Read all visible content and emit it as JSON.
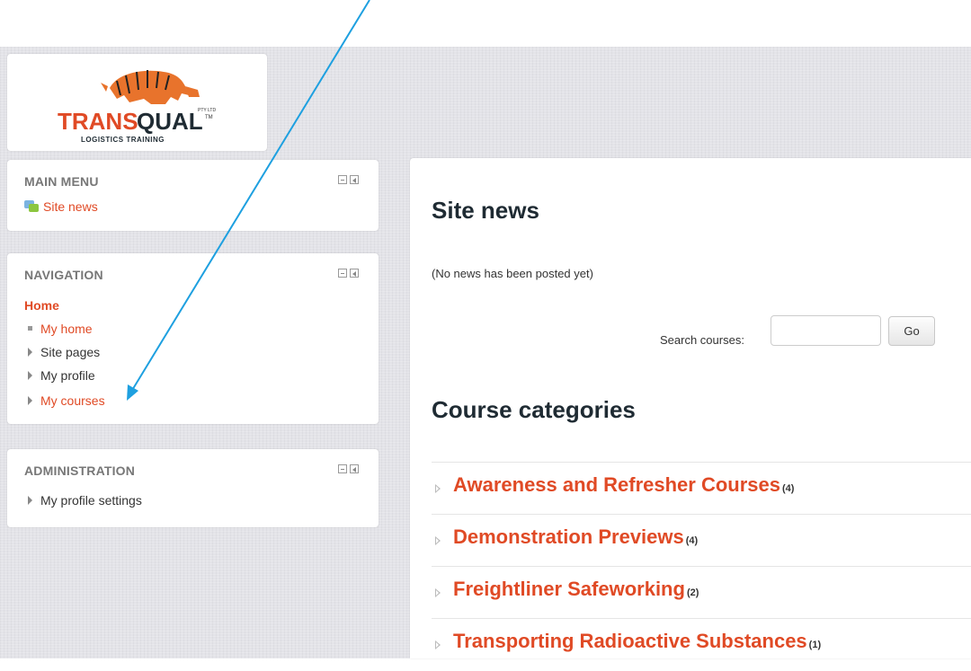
{
  "logo": {
    "brand_left": "TRANS",
    "brand_right": "QUAL",
    "tagline": "LOGISTICS TRAINING",
    "pty": "PTY LTD",
    "tm": "TM"
  },
  "main_menu": {
    "title": "MAIN MENU",
    "items": [
      {
        "label": "Site news",
        "icon": "site-news-icon"
      }
    ]
  },
  "navigation": {
    "title": "NAVIGATION",
    "home": "Home",
    "items": [
      {
        "label": "My home",
        "marker": "square"
      },
      {
        "label": "Site pages",
        "marker": "triangle"
      },
      {
        "label": "My profile",
        "marker": "triangle"
      },
      {
        "label": "My courses",
        "marker": "triangle"
      }
    ]
  },
  "administration": {
    "title": "ADMINISTRATION",
    "items": [
      {
        "label": "My profile settings"
      }
    ]
  },
  "content": {
    "site_news_heading": "Site news",
    "no_news": "(No news has been posted yet)",
    "search_label": "Search courses:",
    "search_value": "",
    "go_label": "Go",
    "categories_heading": "Course categories",
    "categories": [
      {
        "name": "Awareness and Refresher Courses",
        "count": "(4)"
      },
      {
        "name": "Demonstration Previews",
        "count": "(4)"
      },
      {
        "name": "Freightliner Safeworking",
        "count": "(2)"
      },
      {
        "name": "Transporting Radioactive Substances",
        "count": "(1)"
      }
    ]
  },
  "colors": {
    "accent": "#e04a25",
    "annotation_arrow": "#1ea0e0",
    "background": "#e3e3e8"
  }
}
